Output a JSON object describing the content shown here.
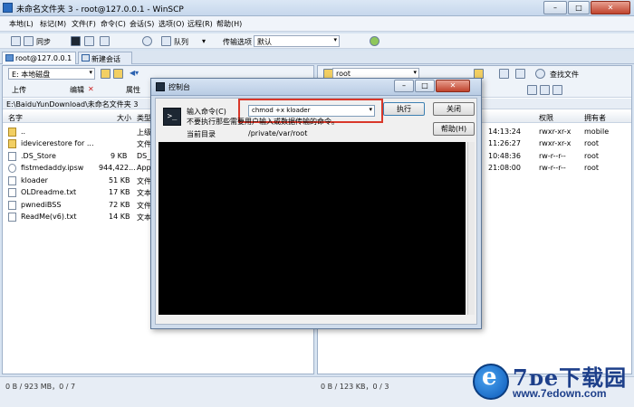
{
  "window": {
    "title": "未命名文件夹 3 - root@127.0.0.1 - WinSCP",
    "minimize": "–",
    "maximize": "□",
    "close": "✕"
  },
  "menu": [
    "本地(L)",
    "标记(M)",
    "文件(F)",
    "命令(C)",
    "会话(S)",
    "选项(O)",
    "远程(R)",
    "帮助(H)"
  ],
  "toolbar": {
    "sync_label": "同步",
    "queue_label": "队列",
    "transfer_label": "传输选项",
    "transfer_value": "默认"
  },
  "tabs": {
    "session": "root@127.0.0.1",
    "new_session": "新建会话"
  },
  "left_panel": {
    "drive": "E: 本地磁盘",
    "upload_label": "上传",
    "edit_label": "编辑",
    "properties_label": "属性",
    "path": "E:\\BaiduYunDownload\\未命名文件夹 3",
    "headers": {
      "name": "名字",
      "size": "大小",
      "type": "类型"
    },
    "rows": [
      {
        "name": "..",
        "size": "",
        "type": "上级"
      },
      {
        "name": "idevicerestore for ...",
        "size": "",
        "type": "文件"
      },
      {
        "name": ".DS_Store",
        "size": "9 KB",
        "type": "DS_"
      },
      {
        "name": "fistmedaddy.ipsw",
        "size": "944,422...",
        "type": "App"
      },
      {
        "name": "kloader",
        "size": "51 KB",
        "type": "文件"
      },
      {
        "name": "OLDreadme.txt",
        "size": "17 KB",
        "type": "文本"
      },
      {
        "name": "pwnediBSS",
        "size": "72 KB",
        "type": "文件"
      },
      {
        "name": "ReadMe(v6).txt",
        "size": "14 KB",
        "type": "文本"
      }
    ],
    "status": "0 B / 923 MB，0 / 7"
  },
  "right_panel": {
    "dir": "root",
    "find_label": "查找文件",
    "headers": {
      "perms": "权限",
      "owner": "拥有者"
    },
    "rows": [
      {
        "time": "14:13:24",
        "perms": "rwxr-xr-x",
        "owner": "mobile"
      },
      {
        "time": "11:26:27",
        "perms": "rwxr-xr-x",
        "owner": "root"
      },
      {
        "time": "10:48:36",
        "perms": "rw-r--r--",
        "owner": "root"
      },
      {
        "time": "21:08:00",
        "perms": "rw-r--r--",
        "owner": "root"
      }
    ],
    "status": "0 B / 123 KB，0 / 3"
  },
  "dialog": {
    "title": "控制台",
    "input_label": "输入命令(C)",
    "command": "chmod +x kloader",
    "warning": "不要执行那些需要用户输入或数据传输的命令。",
    "cwd_label": "当前目录",
    "cwd": "/private/var/root",
    "execute": "执行",
    "close": "关闭",
    "help": "帮助(H)",
    "minimize": "–",
    "maximize": "□",
    "close_x": "✕"
  },
  "watermark": {
    "brand": "下载园",
    "url": "www.7edown.com"
  }
}
